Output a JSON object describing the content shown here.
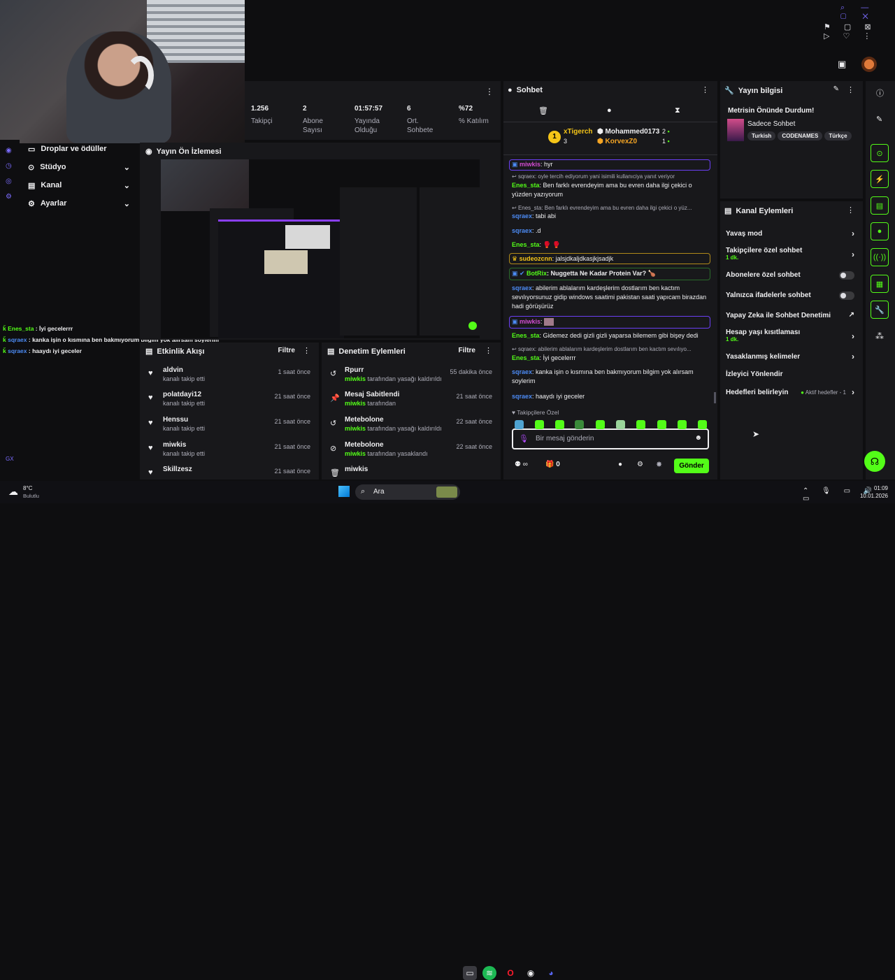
{
  "stats": [
    {
      "value": "1.256",
      "label": "Takipçi"
    },
    {
      "value": "2",
      "label": "Abone Sayısı"
    },
    {
      "value": "01:57:57",
      "label": "Yayında Olduğu"
    },
    {
      "value": "6",
      "label": "Ort. Sohbete"
    },
    {
      "value": "%72",
      "label": "% Katılım"
    }
  ],
  "sidebar": {
    "items": [
      {
        "label": "Droplar ve ödüller"
      },
      {
        "label": "Stüdyo"
      },
      {
        "label": "Kanal"
      },
      {
        "label": "Ayarlar"
      }
    ]
  },
  "preview": {
    "title": "Yayın Ön İzlemesi"
  },
  "overlay_chat": [
    {
      "user": "Enes_sta",
      "text": " : İyi gecelerrr"
    },
    {
      "user": "sqraex",
      "text": " : kanka işin o kısmına ben bakmıyorum bilgim yok alırsam soylerim"
    },
    {
      "user": "sqraex",
      "text": " : haaydı iyi geceler"
    }
  ],
  "activity": {
    "title": "Etkinlik Akışı",
    "filter": "Filtre",
    "rows": [
      {
        "user": "aldvin",
        "sub": "kanalı takip etti",
        "time": "1 saat önce"
      },
      {
        "user": "polatdayi12",
        "sub": "kanalı takip etti",
        "time": "21 saat önce"
      },
      {
        "user": "Henssu",
        "sub": "kanalı takip etti",
        "time": "21 saat önce"
      },
      {
        "user": "miwkis",
        "sub": "kanalı takip etti",
        "time": "21 saat önce"
      },
      {
        "user": "Skillzesz",
        "sub": "",
        "time": "21 saat önce"
      }
    ]
  },
  "moderation": {
    "title": "Denetim Eylemleri",
    "filter": "Filtre",
    "rows": [
      {
        "title": "Rpurr",
        "by": "miwkis",
        "sub": " tarafından yasağı kaldırıldı",
        "time": "55 dakika önce"
      },
      {
        "title": "Mesaj Sabitlendi",
        "by": "miwkis",
        "sub": " tarafından",
        "time": "21 saat önce"
      },
      {
        "title": "Metebolone",
        "by": "miwkis",
        "sub": " tarafından yasağı kaldırıldı",
        "time": "22 saat önce"
      },
      {
        "title": "Metebolone",
        "by": "miwkis",
        "sub": " tarafından yasaklandı",
        "time": "22 saat önce"
      },
      {
        "title": "miwkis",
        "by": "",
        "sub": "",
        "time": ""
      }
    ]
  },
  "chat": {
    "title": "Sohbet",
    "leaders": [
      {
        "name": "xTigerch",
        "count": "3"
      },
      {
        "name": "Mohammed0173",
        "count": "2"
      },
      {
        "name": "KorvexZ0",
        "count": "1"
      }
    ],
    "messages": [
      {
        "user": "miwkis",
        "text": ": hyr",
        "color": "#d14cd1",
        "kind": "user"
      },
      {
        "user": "",
        "text": "sqraex: oyle tercih ediyorum yani isimili kullanıciya yanıt veriyor",
        "color": "#adadb8",
        "kind": "reply"
      },
      {
        "user": "Enes_sta",
        "text": ": Ben farklı evrendeyim ama bu evren daha ilgi çekici o yüzden yazıyorum",
        "color": "#53fc18",
        "kind": "user"
      },
      {
        "user": "",
        "text": "Enes_sta: Ben farklı evrendeyim ama bu evren daha ilgi çekici o yüz...",
        "color": "#adadb8",
        "kind": "reply"
      },
      {
        "user": "sqraex",
        "text": ": tabi abi",
        "color": "#4c8bf5",
        "kind": "user"
      },
      {
        "user": "sqraex",
        "text": ": .d",
        "color": "#4c8bf5",
        "kind": "user"
      },
      {
        "user": "Enes_sta",
        "text": ": 🥊 🥊",
        "color": "#53fc18",
        "kind": "user"
      },
      {
        "user": "sudeozcnn",
        "text": ": jalsjdkaljdkasjkjsadjk",
        "color": "#f5c518",
        "kind": "user"
      },
      {
        "user": "BotRix",
        "text": ": Nuggetta Ne Kadar Protein Var? 🍗",
        "color": "#53fc18",
        "kind": "user"
      },
      {
        "user": "sqraex",
        "text": ": abilerim ablalarım kardeşlerim dostlarım ben kactım sevılıyorsunuz gidip windows saatimi pakistan saati yapıcam birazdan hadi görüşürüz",
        "color": "#4c8bf5",
        "kind": "user"
      },
      {
        "user": "miwkis",
        "text": ":",
        "color": "#d14cd1",
        "kind": "user"
      },
      {
        "user": "Enes_sta",
        "text": ": Gidemez dedi gizli gizli yaparsa bilemem gibi bişey dedi",
        "color": "#53fc18",
        "kind": "user"
      },
      {
        "user": "",
        "text": "sqraex: abilerim ablalarım kardeşlerim dostlarım ben kactım sevılıyo...",
        "color": "#adadb8",
        "kind": "reply"
      },
      {
        "user": "Enes_sta",
        "text": ": İyi gecelerrr",
        "color": "#53fc18",
        "kind": "user"
      },
      {
        "user": "sqraex",
        "text": ": kanka işin o kısmına ben bakmıyorum bilgim yok alırsam soylerim",
        "color": "#4c8bf5",
        "kind": "user"
      },
      {
        "user": "sqraex",
        "text": ": haaydı iyi geceler",
        "color": "#4c8bf5",
        "kind": "user"
      }
    ],
    "followers_only": "Takipçilere Özel",
    "placeholder": "Bir mesaj gönderin",
    "send": "Gönder",
    "gift_count": "0"
  },
  "stream_info": {
    "title": "Yayın bilgisi",
    "stream_title": "Metrisin Önünde Durdum!",
    "category": "Sadece Sohbet",
    "tags": [
      "Turkish",
      "CODENAMES",
      "Türkçe"
    ]
  },
  "channel_actions": {
    "title": "Kanal Eylemleri",
    "rows": [
      {
        "label": "Yavaş mod",
        "sub": "",
        "control": "chevron"
      },
      {
        "label": "Takipçilere özel sohbet",
        "sub": "1 dk.",
        "control": "chevron"
      },
      {
        "label": "Abonelere özel sohbet",
        "sub": "",
        "control": "toggle"
      },
      {
        "label": "Yalnızca ifadelerle sohbet",
        "sub": "",
        "control": "toggle"
      },
      {
        "label": "Yapay Zeka ile Sohbet Denetimi",
        "sub": "",
        "control": "external"
      },
      {
        "label": "Hesap yaşı kısıtlaması",
        "sub": "1 dk.",
        "control": "chevron"
      },
      {
        "label": "Yasaklanmış kelimeler",
        "sub": "",
        "control": "chevron"
      },
      {
        "label": "İzleyici Yönlendir",
        "sub": "",
        "control": "none"
      },
      {
        "label": "Hedefleri belirleyin",
        "sub": "",
        "control": "goals"
      }
    ],
    "goals_label": "Aktif hedefler - 1"
  },
  "taskbar": {
    "weather_temp": "8°C",
    "weather_desc": "Bulutlu",
    "search": "Ara",
    "time": "01:09",
    "date": "10.01.2026"
  },
  "colors": {
    "accent": "#53fc18",
    "panel": "#18181b",
    "bg": "#0e0e10"
  }
}
